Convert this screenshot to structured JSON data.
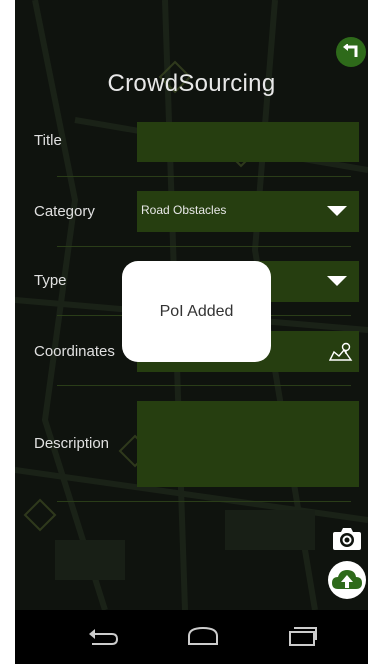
{
  "app": {
    "title": "CrowdSourcing"
  },
  "form": {
    "title_label": "Title",
    "category_label": "Category",
    "category_value": "Road Obstacles",
    "type_label": "Type",
    "coordinates_label": "Coordinates",
    "description_label": "Description"
  },
  "toast": {
    "message": "PoI Added"
  },
  "icons": {
    "back": "back-arrow-icon",
    "dropdown": "dropdown-caret-icon",
    "map": "map-pin-icon",
    "camera": "camera-icon",
    "upload": "cloud-upload-icon",
    "nav_back": "nav-back-icon",
    "nav_home": "nav-home-icon",
    "nav_recents": "nav-recents-icon"
  },
  "colors": {
    "background": "#0f130e",
    "field": "#263e10",
    "accent": "#2e6a1a",
    "toast": "#ffffff"
  }
}
